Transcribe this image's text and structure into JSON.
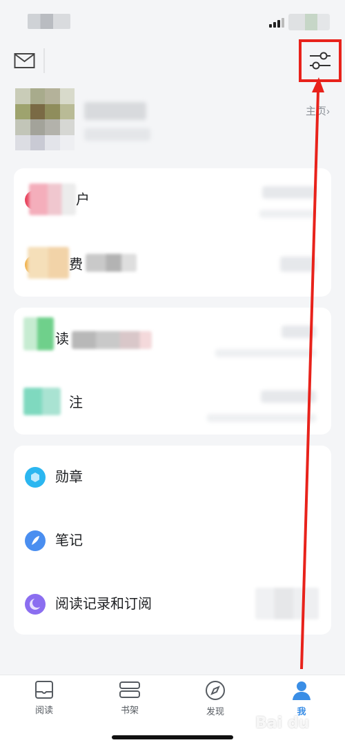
{
  "header": {
    "mail_icon": "mail-icon",
    "settings_icon": "sliders-icon",
    "homepage_label": "主页",
    "homepage_chevron": "›"
  },
  "account_card": {
    "rows": [
      {
        "label_suffix": "户",
        "icon_color": "#e8465f"
      },
      {
        "label_suffix": "费",
        "icon_color": "#f0b04a"
      }
    ]
  },
  "reading_card": {
    "rows": [
      {
        "label": "读",
        "icon_color": "#4cc777"
      },
      {
        "label_suffix": "注",
        "icon_color": "#2bc1a0"
      }
    ]
  },
  "more_card": {
    "rows": [
      {
        "label": "勋章",
        "icon": "badge-icon",
        "icon_color": "#2bb6f0"
      },
      {
        "label": "笔记",
        "icon": "feather-icon",
        "icon_color": "#4a8ef0"
      },
      {
        "label": "阅读记录和订阅",
        "icon": "moon-icon",
        "icon_color": "#8b6ef0"
      }
    ]
  },
  "tabs": [
    {
      "label": "阅读",
      "icon": "book-icon",
      "active": false
    },
    {
      "label": "书架",
      "icon": "bookshelf-icon",
      "active": false
    },
    {
      "label": "发现",
      "icon": "compass-icon",
      "active": false
    },
    {
      "label": "我",
      "icon": "person-icon",
      "active": true
    }
  ],
  "colors": {
    "accent": "#3a8ee6",
    "annotation": "#e8221b",
    "background": "#f4f5f7"
  },
  "watermark": {
    "text": "Bai du",
    "sub": "经验"
  }
}
